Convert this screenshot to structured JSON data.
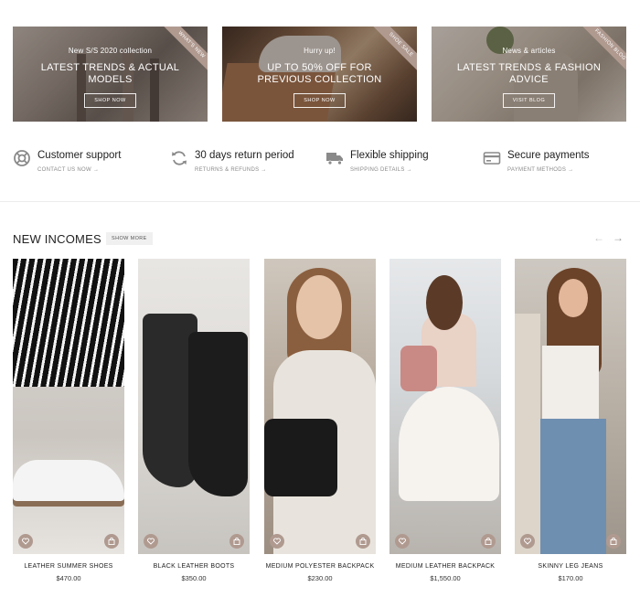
{
  "banners": [
    {
      "kicker": "New S/S 2020 collection",
      "headline": "LATEST TRENDS & ACTUAL MODELS",
      "cta": "SHOP NOW",
      "ribbon": "WHAT'S NEW"
    },
    {
      "kicker": "Hurry up!",
      "headline": "UP TO 50% OFF FOR PREVIOUS COLLECTION",
      "cta": "SHOP NOW",
      "ribbon": "SHOE SALE"
    },
    {
      "kicker": "News & articles",
      "headline": "LATEST TRENDS & FASHION ADVICE",
      "cta": "VISIT BLOG",
      "ribbon": "FASHION BLOG"
    }
  ],
  "features": [
    {
      "icon": "lifebuoy-icon",
      "title": "Customer support",
      "link": "CONTACT US NOW →"
    },
    {
      "icon": "refresh-icon",
      "title": "30 days return period",
      "link": "RETURNS & REFUNDS →"
    },
    {
      "icon": "truck-icon",
      "title": "Flexible shipping",
      "link": "SHIPPING DETAILS →"
    },
    {
      "icon": "credit-card-icon",
      "title": "Secure payments",
      "link": "PAYMENT METHODS →"
    }
  ],
  "section": {
    "title": "NEW INCOMES",
    "show_more": "SHOW MORE",
    "prev": "←",
    "next": "→"
  },
  "products": [
    {
      "name": "LEATHER SUMMER SHOES",
      "price": "$470.00"
    },
    {
      "name": "BLACK LEATHER BOOTS",
      "price": "$350.00"
    },
    {
      "name": "MEDIUM POLYESTER BACKPACK",
      "price": "$230.00"
    },
    {
      "name": "MEDIUM LEATHER BACKPACK",
      "price": "$1,550.00"
    },
    {
      "name": "SKINNY LEG JEANS",
      "price": "$170.00"
    }
  ],
  "colors": {
    "accent": "#b09a90",
    "text": "#222222",
    "muted": "#8a8a8a"
  }
}
